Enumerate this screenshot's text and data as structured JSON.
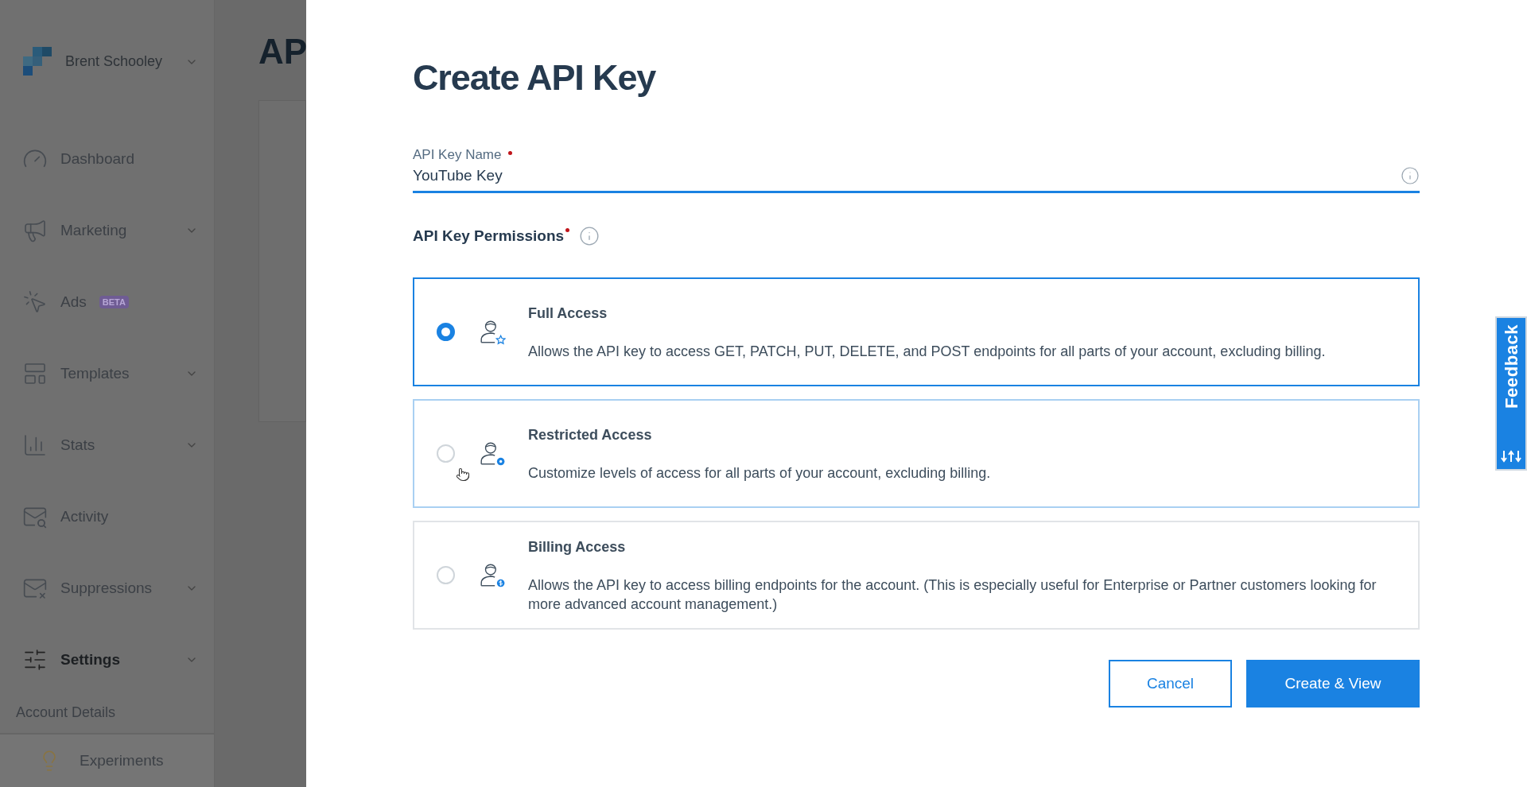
{
  "sidebar": {
    "account": {
      "name": "Brent Schooley"
    },
    "items": [
      {
        "label": "Dashboard",
        "kind": "gauge",
        "expandable": false,
        "selected": false
      },
      {
        "label": "Marketing",
        "kind": "megaphone",
        "expandable": true,
        "selected": false
      },
      {
        "label": "Ads",
        "kind": "target",
        "expandable": false,
        "badge": "BETA",
        "selected": false
      },
      {
        "label": "Templates",
        "kind": "layout",
        "expandable": true,
        "selected": false
      },
      {
        "label": "Stats",
        "kind": "chart",
        "expandable": true,
        "selected": false
      },
      {
        "label": "Activity",
        "kind": "mail-search",
        "expandable": false,
        "selected": false
      },
      {
        "label": "Suppressions",
        "kind": "mail-x",
        "expandable": true,
        "selected": false
      },
      {
        "label": "Settings",
        "kind": "sliders",
        "expandable": true,
        "selected": true
      }
    ],
    "subitems": [
      {
        "label": "Account Details"
      }
    ],
    "footer": {
      "label": "Experiments"
    }
  },
  "page": {
    "title": "AP"
  },
  "modal": {
    "title": "Create API Key",
    "name_field": {
      "label": "API Key Name",
      "required": true,
      "value": "YouTube Key"
    },
    "permissions": {
      "label": "API Key Permissions",
      "required": true,
      "options": [
        {
          "title": "Full Access",
          "description": "Allows the API key to access GET, PATCH, PUT, DELETE, and POST endpoints for all parts of your account, excluding billing.",
          "kind": "star",
          "selected": true,
          "hovered": false
        },
        {
          "title": "Restricted Access",
          "description": "Customize levels of access for all parts of your account, excluding billing.",
          "kind": "gear",
          "selected": false,
          "hovered": true
        },
        {
          "title": "Billing Access",
          "description": "Allows the API key to access billing endpoints for the account. (This is especially useful for Enterprise or Partner customers looking for more advanced account management.)",
          "kind": "dollar",
          "selected": false,
          "hovered": false
        }
      ]
    },
    "buttons": [
      {
        "label": "Cancel",
        "kind": "secondary"
      },
      {
        "label": "Create & View",
        "kind": "primary"
      }
    ]
  },
  "feedback_tab": {
    "label": "Feedback"
  }
}
